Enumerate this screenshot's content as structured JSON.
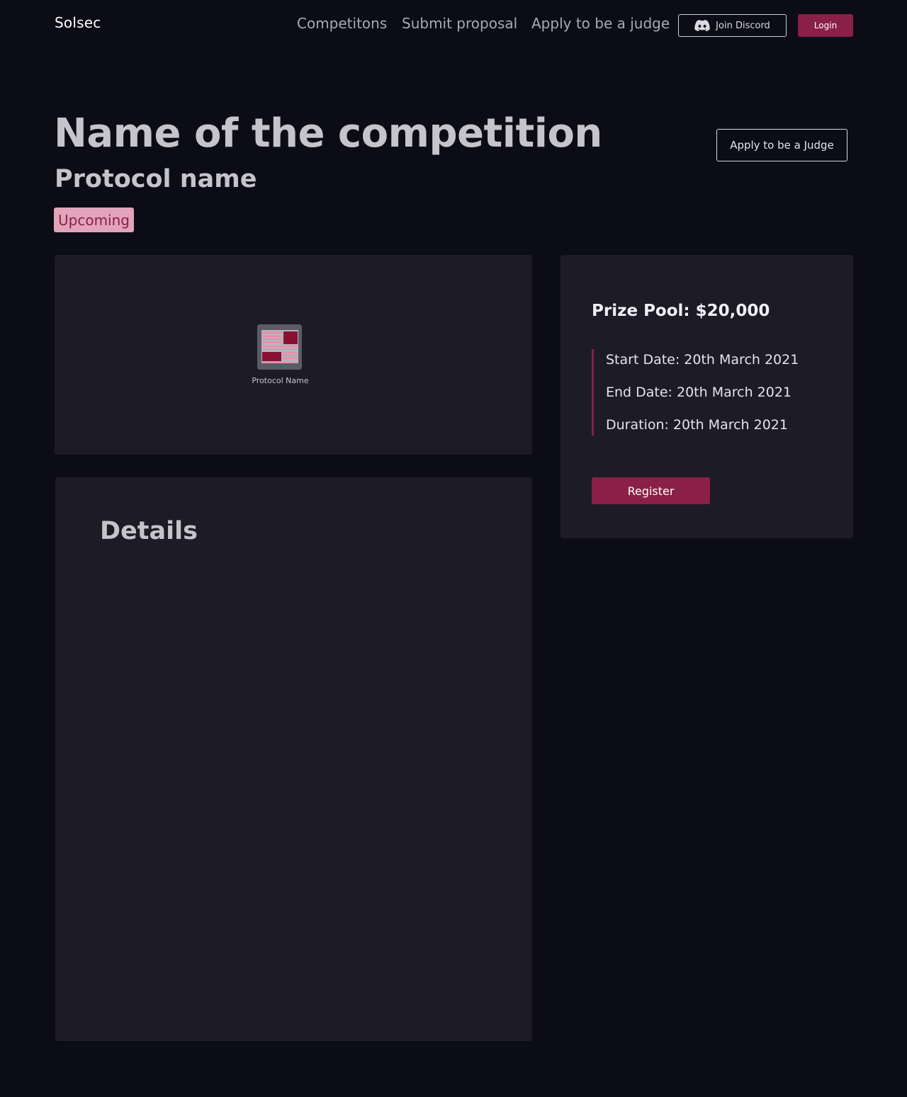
{
  "header": {
    "logo": "Solsec",
    "nav": [
      "Competitons",
      "Submit proposal",
      "Apply to be a judge"
    ],
    "discord_label": "Join Discord",
    "login_label": "Login"
  },
  "hero": {
    "title": "Name of the competition",
    "protocol": "Protocol name",
    "status": "Upcoming",
    "judge_button": "Apply to be a Judge"
  },
  "banner": {
    "logo_label": "Protocol Name"
  },
  "info": {
    "prize": "Prize Pool: $20,000",
    "start": "Start Date: 20th March 2021",
    "end": "End Date: 20th March 2021",
    "duration": "Duration: 20th March 2021",
    "register_label": "Register"
  },
  "details": {
    "title": "Details"
  },
  "colors": {
    "background": "#0c0c17",
    "card": "#1c1b26",
    "accent": "#8a2046",
    "badge_bg": "#e2a4bb"
  }
}
